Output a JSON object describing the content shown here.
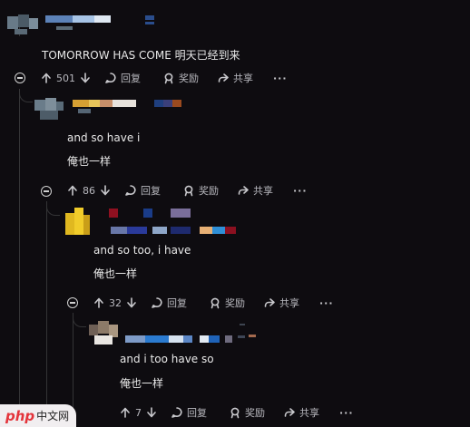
{
  "comments": [
    {
      "text_lines": [
        "TOMORROW HAS COME  明天已经到来"
      ],
      "actions": {
        "votes": "501",
        "reply": "回复",
        "award": "奖励",
        "share": "共享",
        "more": "···"
      }
    },
    {
      "text_lines": [
        "and so have i",
        "俺也一样"
      ],
      "actions": {
        "votes": "86",
        "reply": "回复",
        "award": "奖励",
        "share": "共享",
        "more": "···"
      }
    },
    {
      "text_lines": [
        "and so too, i have",
        "俺也一样"
      ],
      "actions": {
        "votes": "32",
        "reply": "回复",
        "award": "奖励",
        "share": "共享",
        "more": "···"
      }
    },
    {
      "text_lines": [
        "and i too have so",
        "俺也一样"
      ],
      "actions": {
        "votes": "7",
        "reply": "回复",
        "award": "奖励",
        "share": "共享",
        "more": "···"
      }
    }
  ],
  "watermark": {
    "brand": "php",
    "suffix": "中文网"
  },
  "colors": {
    "background": "#0e0c10",
    "thread_line": "#343436",
    "text": "#e8e8e8",
    "muted": "#b8b8be"
  }
}
